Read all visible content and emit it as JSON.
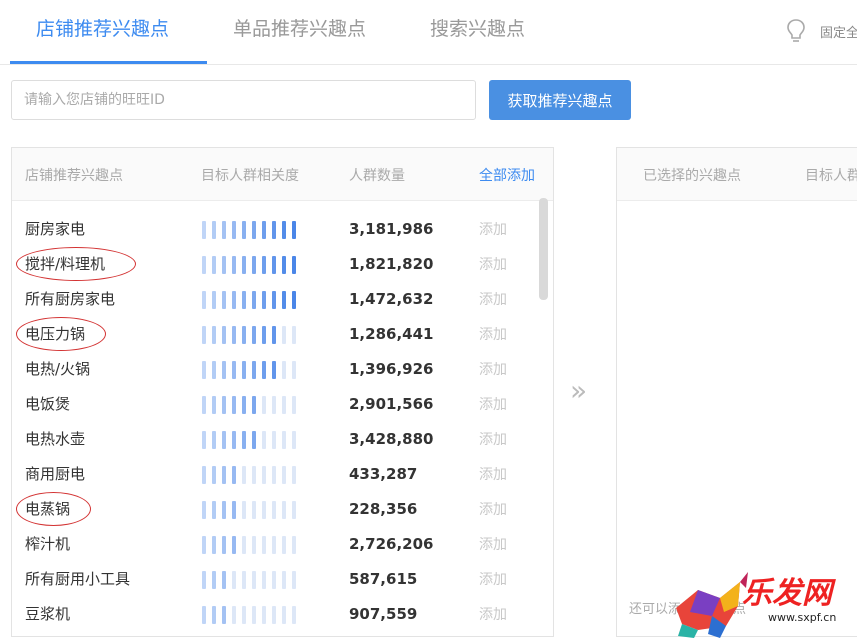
{
  "tabs": [
    {
      "label": "店铺推荐兴趣点",
      "active": true
    },
    {
      "label": "单品推荐兴趣点",
      "active": false
    },
    {
      "label": "搜索兴趣点",
      "active": false
    }
  ],
  "pin": {
    "icon": "lightbulb-icon",
    "label": "固定全"
  },
  "search": {
    "placeholder": "请输入您店铺的旺旺ID",
    "value": ""
  },
  "fetch_button": "获取推荐兴趣点",
  "left_panel": {
    "headers": {
      "name": "店铺推荐兴趣点",
      "relevance": "目标人群相关度",
      "count": "人群数量",
      "add_all": "全部添加"
    },
    "rows": [
      {
        "name": "厨房家电",
        "relevance_level": 10,
        "count": "3,181,986",
        "action": "添加",
        "circled": false
      },
      {
        "name": "搅拌/料理机",
        "relevance_level": 10,
        "count": "1,821,820",
        "action": "添加",
        "circled": true
      },
      {
        "name": "所有厨房家电",
        "relevance_level": 10,
        "count": "1,472,632",
        "action": "添加",
        "circled": false
      },
      {
        "name": "电压力锅",
        "relevance_level": 8,
        "count": "1,286,441",
        "action": "添加",
        "circled": true
      },
      {
        "name": "电热/火锅",
        "relevance_level": 8,
        "count": "1,396,926",
        "action": "添加",
        "circled": false
      },
      {
        "name": "电饭煲",
        "relevance_level": 6,
        "count": "2,901,566",
        "action": "添加",
        "circled": false
      },
      {
        "name": "电热水壶",
        "relevance_level": 6,
        "count": "3,428,880",
        "action": "添加",
        "circled": false
      },
      {
        "name": "商用厨电",
        "relevance_level": 4,
        "count": "433,287",
        "action": "添加",
        "circled": false
      },
      {
        "name": "电蒸锅",
        "relevance_level": 4,
        "count": "228,356",
        "action": "添加",
        "circled": true
      },
      {
        "name": "榨汁机",
        "relevance_level": 4,
        "count": "2,726,206",
        "action": "添加",
        "circled": false
      },
      {
        "name": "所有厨用小工具",
        "relevance_level": 3,
        "count": "587,615",
        "action": "添加",
        "circled": false
      },
      {
        "name": "豆浆机",
        "relevance_level": 3,
        "count": "907,559",
        "action": "添加",
        "circled": false
      }
    ]
  },
  "right_panel": {
    "headers": {
      "name": "已选择的兴趣点",
      "relevance": "目标人群"
    },
    "hint": "还可以添加个兴趣点"
  },
  "watermark": {
    "text": "乐发网",
    "url": "www.sxpf.cn"
  },
  "colors": {
    "accent": "#3d8bf0",
    "meter_strong": "#4a86e8",
    "meter_weak": "#dde7f7",
    "annotation": "#d33333"
  }
}
